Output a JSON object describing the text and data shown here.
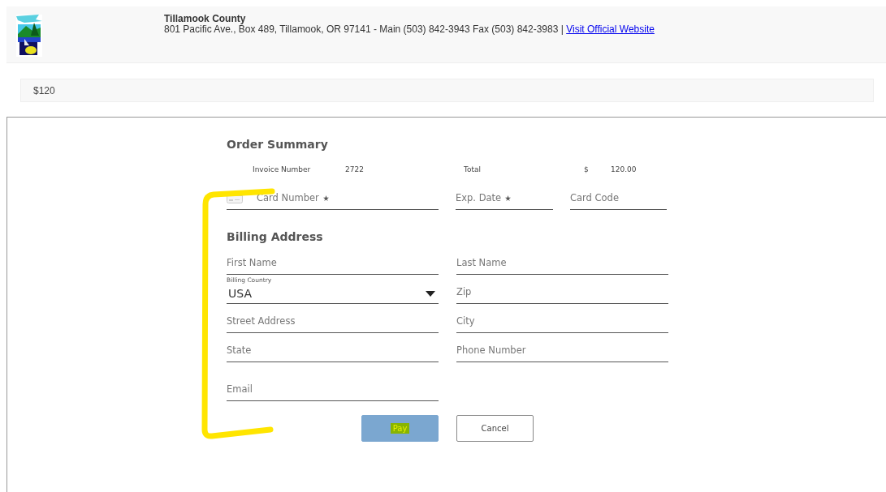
{
  "header": {
    "title": "Tillamook County",
    "address": "801 Pacific Ave., Box 489, Tillamook, OR 97141 - Main (503) 842-3943 Fax (503) 842-3983 |",
    "link": "Visit Official Website"
  },
  "amount": "$120",
  "order_summary": {
    "title": "Order Summary",
    "invoice_label": "Invoice Number",
    "invoice_number": "2722",
    "total_label": "Total",
    "currency": "$",
    "total": "120.00"
  },
  "card_fields": [
    {
      "kind": "card",
      "placeholder": "Card Number",
      "required": true
    },
    {
      "kind": "text",
      "placeholder": "Exp. Date",
      "required": true
    },
    {
      "kind": "text",
      "placeholder": "Card Code",
      "required": false
    }
  ],
  "billing": {
    "title": "Billing Address",
    "fields": [
      {
        "kind": "text",
        "placeholder": "First Name"
      },
      {
        "kind": "text",
        "placeholder": "Last Name"
      },
      {
        "kind": "select",
        "label": "Billing Country",
        "value": "USA"
      },
      {
        "kind": "text",
        "placeholder": "Zip"
      },
      {
        "kind": "text",
        "placeholder": "Street Address"
      },
      {
        "kind": "text",
        "placeholder": "City"
      },
      {
        "kind": "text",
        "placeholder": "State"
      },
      {
        "kind": "text",
        "placeholder": "Phone Number"
      },
      {
        "kind": "text",
        "placeholder": "Email"
      }
    ]
  },
  "buttons": [
    {
      "kind": "primary",
      "label": "Pay"
    },
    {
      "kind": "secondary",
      "label": "Cancel"
    }
  ]
}
